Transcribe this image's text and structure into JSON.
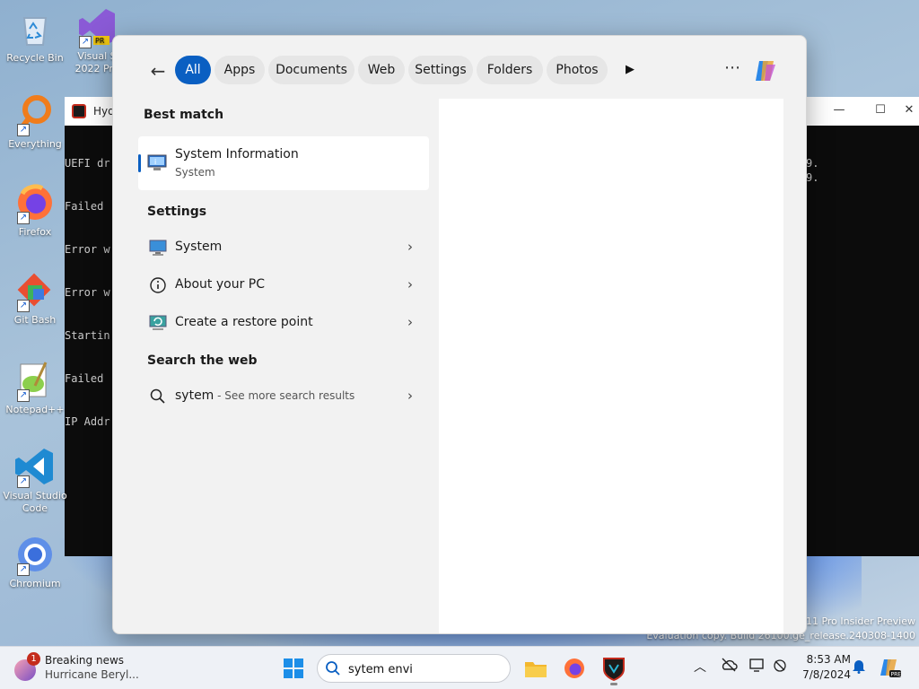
{
  "desktop": {
    "icons": [
      {
        "label": "Recycle Bin",
        "icon": "recycle-bin-icon"
      },
      {
        "label": "Everything",
        "icon": "everything-icon"
      },
      {
        "label": "Firefox",
        "icon": "firefox-icon"
      },
      {
        "label": "Git Bash",
        "icon": "git-bash-icon"
      },
      {
        "label": "Notepad++",
        "icon": "notepadpp-icon"
      },
      {
        "label": "Visual Studio Code",
        "icon": "vscode-icon"
      },
      {
        "label": "Chromium",
        "icon": "chromium-icon"
      }
    ],
    "vs_icon_label": "Visual S\n2022 Pre",
    "watermark_line1": "11 Pro Insider Preview",
    "watermark_line2": "Evaluation copy. Build 26100.ge_release.240308-1400"
  },
  "background_window": {
    "title": "Hydr",
    "terminal_lines": [
      "UEFI dr",
      "Failed ",
      "Error w",
      "Error w",
      "Startin",
      "Failed ",
      "IP Addr"
    ],
    "right_fragments": [
      "9.",
      "9."
    ]
  },
  "search_panel": {
    "filters": [
      "All",
      "Apps",
      "Documents",
      "Web",
      "Settings",
      "Folders",
      "Photos"
    ],
    "active_filter": "All",
    "sections": {
      "best_match": "Best match",
      "settings": "Settings",
      "search_web": "Search the web"
    },
    "best_match": {
      "title": "System Information",
      "subtitle": "System"
    },
    "settings_items": [
      {
        "label": "System",
        "icon": "system-display-icon"
      },
      {
        "label": "About your PC",
        "icon": "info-icon"
      },
      {
        "label": "Create a restore point",
        "icon": "restore-point-icon"
      }
    ],
    "web_result": {
      "query": "sytem",
      "suffix": " - See more search results"
    }
  },
  "taskbar": {
    "news_title": "Breaking news",
    "news_subtitle": "Hurricane Beryl...",
    "news_badge": "1",
    "search_value": "sytem envi",
    "time": "8:53 AM",
    "date": "7/8/2024"
  },
  "colors": {
    "accent": "#0a5fc2",
    "panel_bg": "#f2f2f2"
  }
}
